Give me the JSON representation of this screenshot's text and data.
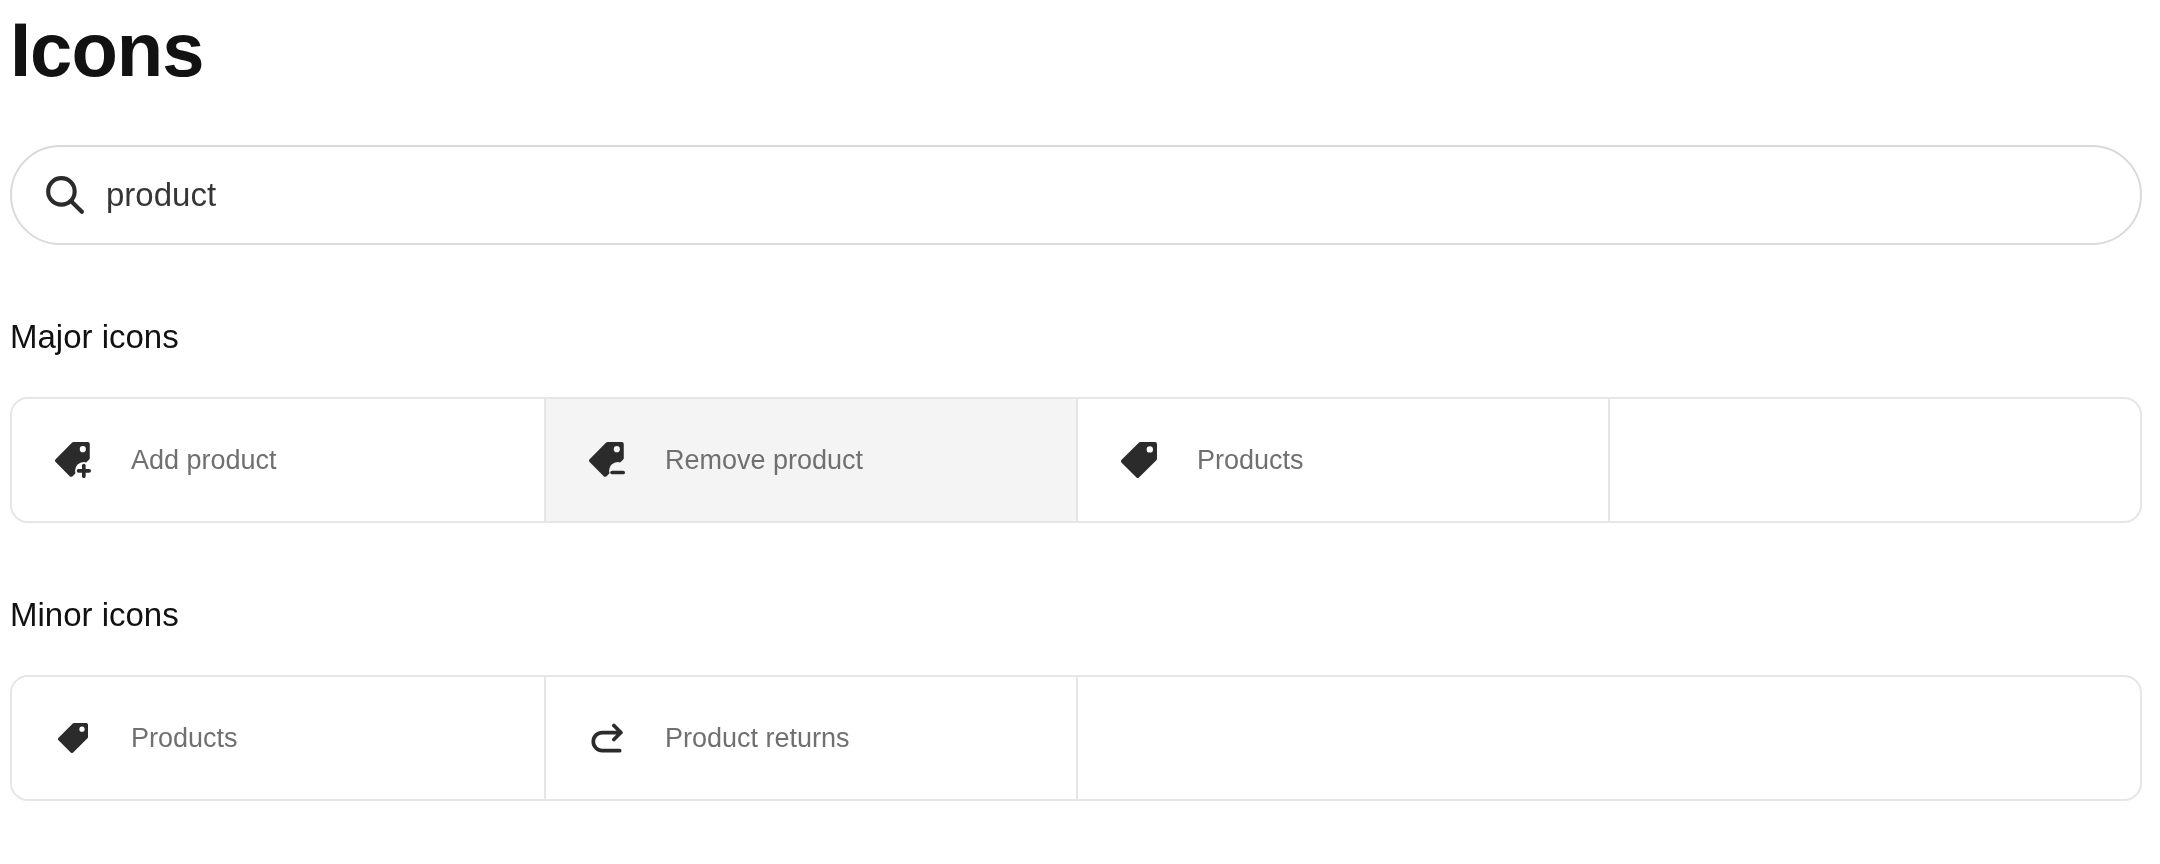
{
  "page": {
    "title": "Icons"
  },
  "search": {
    "value": "product"
  },
  "sections": [
    {
      "heading": "Major icons",
      "kind": "major",
      "icons": [
        {
          "kind": "tag-plus",
          "label": "Add product",
          "selected": false
        },
        {
          "kind": "tag-minus",
          "label": "Remove product",
          "selected": true
        },
        {
          "kind": "tag",
          "label": "Products",
          "selected": false
        }
      ]
    },
    {
      "heading": "Minor icons",
      "kind": "minor",
      "icons": [
        {
          "kind": "tag",
          "label": "Products",
          "selected": false
        },
        {
          "kind": "return",
          "label": "Product returns",
          "selected": false
        }
      ]
    }
  ]
}
